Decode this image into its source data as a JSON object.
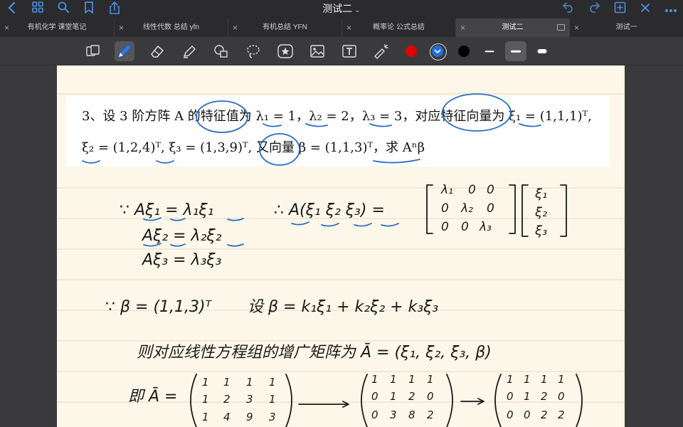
{
  "app": {
    "title": "测试二",
    "colors": {
      "accent": "#4a90e2",
      "ink_blue": "#2b6cc4",
      "red": "#e00000",
      "blue": "#1f6fe0",
      "black": "#000000"
    }
  },
  "topbar": {
    "icons": [
      "chevron-left-icon",
      "grid-icon",
      "search-icon",
      "bookmark-icon",
      "share-icon",
      "undo-icon",
      "redo-icon",
      "add-page-icon",
      "close-icon",
      "more-icon"
    ]
  },
  "tabs": [
    {
      "label": "有机化学 课堂笔记",
      "active": false
    },
    {
      "label": "线性代数 总结 yfn",
      "active": false
    },
    {
      "label": "有机总结 YFN",
      "active": false
    },
    {
      "label": "概率论 公式总结",
      "active": false
    },
    {
      "label": "测试二",
      "active": true
    },
    {
      "label": "测试一",
      "active": false
    }
  ],
  "toolbar": {
    "tools": [
      "page-view-icon",
      "pen-icon",
      "eraser-icon",
      "highlighter-icon",
      "shape-lasso-icon",
      "lasso-icon",
      "sticker-icon",
      "image-icon",
      "text-icon",
      "laser-pointer-icon"
    ],
    "selected_tool": "pen-icon",
    "selected_color": "#1f6fe0"
  },
  "problem": {
    "line1": "3、设 3 阶方阵 A 的特征值为 λ₁ = 1，λ₂ = 2，λ₃ = 3，对应特征向量为 ξ₁ = (1,1,1)ᵀ,",
    "line2": "ξ₂ = (1,2,4)ᵀ, ξ₃ = (1,3,9)ᵀ, 又向量 β = (1,1,3)ᵀ，求 Aⁿβ"
  },
  "handwriting": {
    "eq1": "∵ Aξ₁ = λ₁ξ₁",
    "eq2": "Aξ₂ = λ₂ξ₂",
    "eq3": "Aξ₃ = λ₃ξ₃",
    "matrix_eq_left": "∴ A(ξ₁ ξ₂ ξ₃) =",
    "diag": [
      [
        "λ₁",
        "0",
        "0"
      ],
      [
        "0",
        "λ₂",
        "0"
      ],
      [
        "0",
        "0",
        "λ₃"
      ]
    ],
    "xi_col": [
      "ξ₁",
      "ξ₂",
      "ξ₃"
    ],
    "beta_line": "∵ β = (1,1,3)ᵀ",
    "set_line": "设 β = k₁ξ₁ + k₂ξ₂ + k₃ξ₃",
    "aug_line": "则对应线性方程组的增广矩阵为 Ā = (ξ₁, ξ₂, ξ₃, β)",
    "ji": "即 Ā =",
    "m1": [
      [
        "1",
        "1",
        "1",
        "1"
      ],
      [
        "1",
        "2",
        "3",
        "1"
      ],
      [
        "1",
        "4",
        "9",
        "3"
      ]
    ],
    "m2": [
      [
        "1",
        "1",
        "1",
        "1"
      ],
      [
        "0",
        "1",
        "2",
        "0"
      ],
      [
        "0",
        "3",
        "8",
        "2"
      ]
    ],
    "m3": [
      [
        "1",
        "1",
        "1",
        "1"
      ],
      [
        "0",
        "1",
        "2",
        "0"
      ],
      [
        "0",
        "0",
        "2",
        "2"
      ]
    ]
  }
}
